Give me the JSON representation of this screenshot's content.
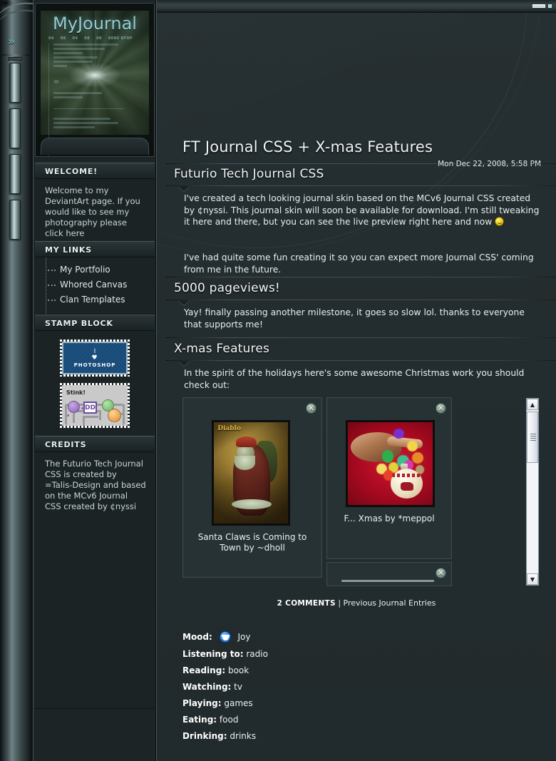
{
  "window": {
    "minimize_label": "minimize",
    "accent_color": "#9fd8dd"
  },
  "rail": {
    "expand_label": "»",
    "tabs": [
      "nav-tab-1",
      "nav-tab-2",
      "nav-tab-3",
      "nav-tab-4"
    ]
  },
  "sidebar": {
    "header": {
      "title": "MyJournal",
      "nav": [
        "04",
        "08",
        "04",
        "08",
        "08",
        "8080 DFDF"
      ]
    },
    "blocks": [
      {
        "heading": "WELCOME!",
        "text": "Welcome to my DeviantArt page. If you would like to see my photography please click here"
      },
      {
        "heading": "MY LINKS",
        "links": [
          "My Portfolio",
          "Whored Canvas",
          "Clan Templates"
        ]
      },
      {
        "heading": "STAMP BLOCK",
        "stamps": [
          {
            "line1": "I",
            "line2": "♥",
            "line3": "PHOTOSHOP"
          },
          {
            "label": "Stink!",
            "badge": "DD"
          }
        ]
      },
      {
        "heading": "CREDITS",
        "text": "The Futurio Tech Journal CSS is created by =Talis-Design and based on the MCv6 Journal CSS created by ¢nyssi"
      }
    ]
  },
  "journal": {
    "title": "FT Journal CSS + X-mas Features",
    "date": "Mon Dec 22, 2008, 5:58 PM",
    "sections": [
      {
        "heading": "Futurio Tech Journal CSS",
        "paragraphs": [
          "I've created a tech looking journal skin based on the MCv6 Journal CSS created by ¢nyssi. This journal skin will soon be available for download. I'm still tweaking it here and there, but you can see the live preview right here and now",
          "I've had quite some fun creating it so you can expect more Journal CSS' coming from me in the future."
        ],
        "has_emoji": true
      },
      {
        "heading": "5000 pageviews!",
        "paragraphs": [
          "Yay! finally passing another milestone, it goes so slow lol. thanks to everyone that supports me!"
        ]
      },
      {
        "heading": "X-mas Features",
        "paragraphs": [
          "In the spirit of the holidays here's some awesome Christmas work you should check out:"
        ]
      }
    ],
    "thumbnails": [
      {
        "caption": "Santa Claws is Coming to Town by ~dholl",
        "close_label": "✕"
      },
      {
        "caption": "F... Xmas by *meppol",
        "close_label": "✕"
      },
      {
        "caption": "",
        "close_label": "✕"
      }
    ],
    "footer": {
      "comments": "2 COMMENTS",
      "separator": "|",
      "previous_link": "Previous Journal Entries"
    },
    "metadata": [
      {
        "label": "Mood:",
        "value": "Joy",
        "icon": "mood-smiley-icon"
      },
      {
        "label": "Listening to:",
        "value": "radio"
      },
      {
        "label": "Reading:",
        "value": "book"
      },
      {
        "label": "Watching:",
        "value": "tv"
      },
      {
        "label": "Playing:",
        "value": "games"
      },
      {
        "label": "Eating:",
        "value": "food"
      },
      {
        "label": "Drinking:",
        "value": "drinks"
      }
    ]
  },
  "scrollbar": {
    "up_arrow": "▲",
    "down_arrow": "▼"
  }
}
